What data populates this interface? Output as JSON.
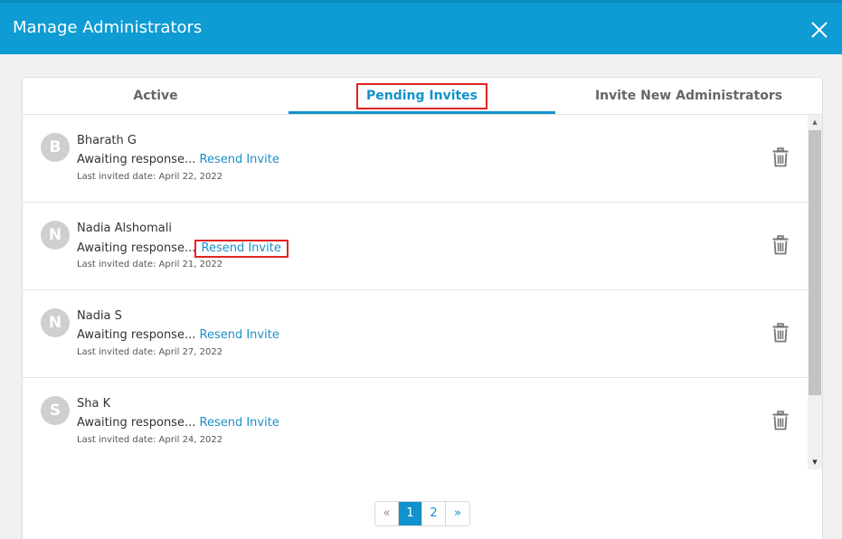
{
  "header": {
    "title": "Manage Administrators"
  },
  "tabs": [
    {
      "label": "Active"
    },
    {
      "label": "Pending Invites"
    },
    {
      "label": "Invite New Administrators"
    }
  ],
  "active_tab": "Pending Invites",
  "invites": [
    {
      "initial": "B",
      "name": "Bharath G",
      "status": "Awaiting response...",
      "resend_label": "Resend Invite",
      "date_label": "Last invited date:",
      "date": "April 22, 2022"
    },
    {
      "initial": "N",
      "name": "Nadia Alshomali",
      "status": "Awaiting response...",
      "resend_label": "Resend Invite",
      "date_label": "Last invited date:",
      "date": "April 21, 2022"
    },
    {
      "initial": "N",
      "name": "Nadia S",
      "status": "Awaiting response...",
      "resend_label": "Resend Invite",
      "date_label": "Last invited date:",
      "date": "April 27, 2022"
    },
    {
      "initial": "S",
      "name": "Sha K",
      "status": "Awaiting response...",
      "resend_label": "Resend Invite",
      "date_label": "Last invited date:",
      "date": "April 24, 2022"
    }
  ],
  "pagination": {
    "prev": "«",
    "pages": [
      "1",
      "2"
    ],
    "current": "1",
    "next": "»"
  },
  "colors": {
    "header": "#0f9bd3",
    "accent": "#1292cc",
    "link": "#1a8fc9",
    "highlight": "#e02424",
    "avatar": "#cfcfcf"
  },
  "icons": {
    "close": "close-icon",
    "delete": "trash-icon",
    "scroll_up": "scroll-up-arrow-icon",
    "scroll_down": "scroll-down-arrow-icon"
  }
}
